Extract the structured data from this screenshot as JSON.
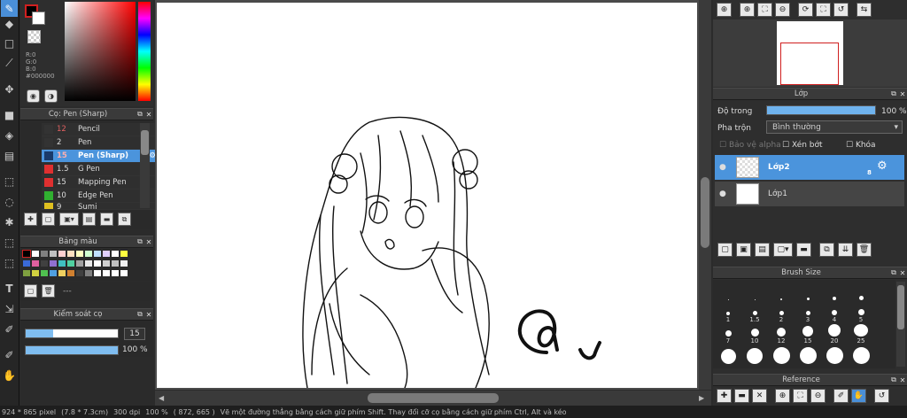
{
  "toolbar": {
    "tools": [
      "brush-icon",
      "eraser-icon",
      "rectangle-select-icon",
      "pen-tool-icon",
      "move-icon",
      "fill-rect-icon",
      "bucket-fill-icon",
      "gradient-icon",
      "dotted-select-icon",
      "lasso-icon",
      "magic-wand-icon",
      "select-pen-icon",
      "select-eraser-icon",
      "text-icon",
      "divide-icon",
      "eyedropper-icon",
      "eyedropper-2-icon",
      "hand-icon"
    ],
    "active": 0
  },
  "color": {
    "fg": "#000000",
    "rgb_r": "R:0",
    "rgb_g": "G:0",
    "rgb_b": "B:0",
    "hex": "#000000"
  },
  "brush_panel": {
    "title": "Cọ: Pen (Sharp)",
    "items": [
      {
        "size": "12",
        "name": "Pencil",
        "color": "#333333"
      },
      {
        "size": "2",
        "name": "Pen",
        "color": "#333333"
      },
      {
        "size": "15",
        "name": "Pen (Sharp)",
        "color": "#1a3a6a",
        "selected": true
      },
      {
        "size": "1.5",
        "name": "G Pen",
        "color": "#e03030"
      },
      {
        "size": "15",
        "name": "Mapping Pen",
        "color": "#e03030"
      },
      {
        "size": "10",
        "name": "Edge Pen",
        "color": "#30b030"
      },
      {
        "size": "9",
        "name": "Sumi",
        "color": "#e0c020"
      }
    ]
  },
  "palette_panel": {
    "title": "Bảng màu",
    "empty_label": "---",
    "colors": [
      "#000000",
      "#ffffff",
      "#808080",
      "#c0c0c0",
      "#ffd0d0",
      "#ffe0c0",
      "#ffffc0",
      "#d0ffd0",
      "#c0e0ff",
      "#e0d0ff",
      "#ffffff",
      "#ffff40",
      "#3a6ad8",
      "#e060a0",
      "#404040",
      "#9070d0",
      "#40c0c0",
      "#50d0a0",
      "#a0a0a0",
      "#e8e8e8",
      "#ffffff",
      "#d0d0d0",
      "#c0c0c0",
      "#f0f0f0",
      "#7fa040",
      "#d0d040",
      "#50c050",
      "#50a0e0",
      "#f0d060",
      "#d08030",
      "#404040",
      "#808080",
      "#ffffff",
      "#ffffff",
      "#ffffff",
      "#ffffff"
    ]
  },
  "control_panel": {
    "title": "Kiểm soát cọ",
    "size_value": "15",
    "size_fraction": 0.3,
    "opacity_value": "100 %",
    "opacity_fraction": 1.0
  },
  "status": {
    "dimensions": "924 * 865 pixel",
    "physical": "(7.8 * 7.3cm)",
    "dpi": "300 dpi",
    "zoom": "100 %",
    "coords": "( 872, 665 )",
    "hint": "Vẽ một đường thẳng bằng cách giữ phím Shift. Thay đổi cỡ cọ bằng cách giữ phím Ctrl, Alt và kéo"
  },
  "navigator": {
    "buttons": [
      "zoom-in-icon",
      "zoom-in-2-icon",
      "fit-icon",
      "zoom-out-icon",
      "rotate-icon",
      "fullscreen-icon",
      "reset-rotate-icon",
      "flip-icon"
    ]
  },
  "layer_panel": {
    "title": "Lớp",
    "opacity_label": "Độ trong",
    "opacity_value": "100 %",
    "opacity_fraction": 1.0,
    "blend_label": "Pha trộn",
    "blend_value": "Bình thường",
    "protect_alpha": "Bảo vệ alpha",
    "clipping": "Xén bớt",
    "lock": "Khóa",
    "layers": [
      {
        "name": "Lớp2",
        "selected": true,
        "badge": "8"
      },
      {
        "name": "Lớp1",
        "selected": false
      }
    ]
  },
  "brush_size_panel": {
    "title": "Brush Size",
    "sizes": [
      "",
      "",
      "",
      "",
      "",
      "",
      "1",
      "1.5",
      "2",
      "3",
      "4",
      "5",
      "7",
      "10",
      "12",
      "15",
      "20",
      "25",
      "",
      "",
      "",
      "",
      "",
      ""
    ]
  },
  "reference_panel": {
    "title": "Reference"
  }
}
